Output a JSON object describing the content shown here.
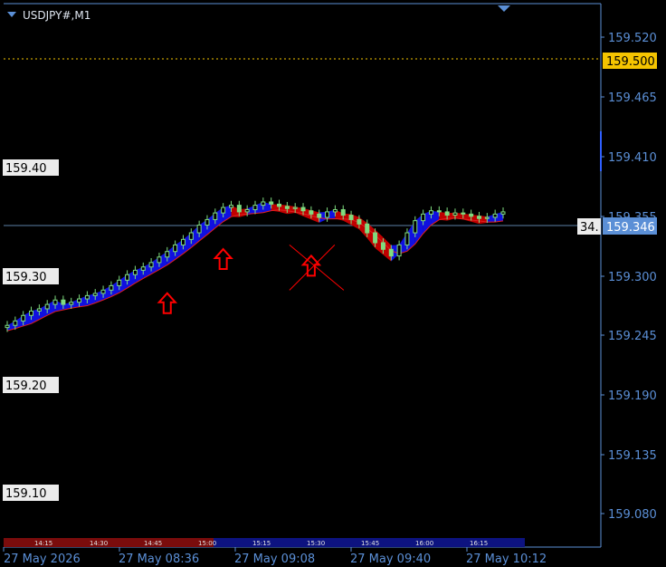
{
  "window": {
    "symbol_title": "USDJPY#,M1"
  },
  "price_axis": {
    "ticks": [
      "159.520",
      "159.465",
      "159.410",
      "159.355",
      "159.300",
      "159.245",
      "159.190",
      "159.135",
      "159.080"
    ],
    "alert_level": "159.500",
    "current_price": "159.346",
    "spread_tag": "34."
  },
  "level_labels": [
    "159.40",
    "159.30",
    "159.20",
    "159.10"
  ],
  "time_axis": [
    "27 May 2026",
    "27 May 08:36",
    "27 May 09:08",
    "27 May 09:40",
    "27 May 10:12"
  ],
  "session_bar": [
    "14:15",
    "14:30",
    "14:45",
    "15:00",
    "15:15",
    "15:30",
    "15:45",
    "16:00",
    "16:15"
  ],
  "colors": {
    "background": "#000000",
    "axis": "#5b8fd6",
    "bull_candle": "#7fdc7f",
    "bear_candle": "#7fdc7f",
    "ribbon_up": "#1010e0",
    "ribbon_down": "#c00000",
    "signal_arrow": "#ff0000",
    "alert_line": "#f5c400",
    "price_line": "#5b7fa6"
  },
  "chart_data": {
    "type": "candlestick",
    "title": "USDJPY#,M1",
    "ylim": [
      159.05,
      159.535
    ],
    "x_labels": [
      "27 May 2026",
      "27 May 08:36",
      "27 May 09:08",
      "27 May 09:40",
      "27 May 10:12"
    ],
    "series": [
      {
        "name": "price",
        "close": [
          159.243,
          159.247,
          159.252,
          159.256,
          159.258,
          159.262,
          159.266,
          159.262,
          159.264,
          159.267,
          159.27,
          159.272,
          159.275,
          159.279,
          159.284,
          159.289,
          159.293,
          159.296,
          159.3,
          159.305,
          159.31,
          159.316,
          159.321,
          159.327,
          159.334,
          159.339,
          159.345,
          159.35,
          159.352,
          159.346,
          159.348,
          159.352,
          159.355,
          159.353,
          159.351,
          159.349,
          159.35,
          159.347,
          159.344,
          159.341,
          159.346,
          159.348,
          159.343,
          159.339,
          159.335,
          159.327,
          159.318,
          159.312,
          159.306,
          159.316,
          159.327,
          159.338,
          159.344,
          159.347,
          159.346,
          159.343,
          159.345,
          159.344,
          159.342,
          159.34,
          159.341,
          159.344,
          159.346
        ]
      }
    ],
    "signals": [
      {
        "type": "buy",
        "index": 20
      },
      {
        "type": "buy",
        "index": 27
      },
      {
        "type": "buy-cancelled",
        "index": 38
      }
    ]
  }
}
